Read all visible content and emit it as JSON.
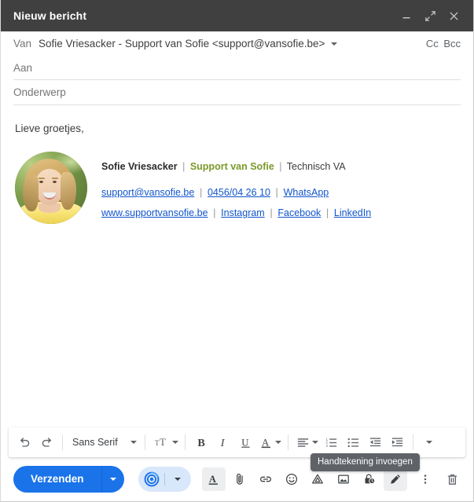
{
  "window": {
    "title": "Nieuw bericht",
    "buttons": [
      {
        "name": "minimize",
        "label": "Minimaliseren"
      },
      {
        "name": "expand",
        "label": "Volledig scherm"
      },
      {
        "name": "close",
        "label": "Sluiten"
      }
    ]
  },
  "fields": {
    "from_label": "Van",
    "from_value": "Sofie Vriesacker - Support van Sofie <support@vansofie.be>",
    "cc": "Cc",
    "bcc": "Bcc",
    "to_placeholder": "Aan",
    "subject_placeholder": "Onderwerp"
  },
  "body": {
    "greeting": "Lieve groetjes,",
    "signature": {
      "avatar_alt": "Sofie Vriesacker portret",
      "name": "Sofie Vriesacker",
      "brand": "Support van Sofie",
      "role": "Technisch VA",
      "separator": "|",
      "contact_links": [
        "support@vansofie.be",
        "0456/04 26 10",
        "WhatsApp"
      ],
      "social_links": [
        "www.supportvansofie.be",
        "Instagram",
        "Facebook",
        "LinkedIn"
      ]
    }
  },
  "format_toolbar": {
    "undo": "Ongedaan maken",
    "redo": "Opnieuw",
    "font_family": "Sans Serif",
    "font_size": "Tekengrootte",
    "bold": "Vet",
    "italic": "Cursief",
    "underline": "Onderstrepen",
    "text_color": "Tekstkleur",
    "align": "Uitlijnen",
    "numbered_list": "Genummerde lijst",
    "bulleted_list": "Lijst met opsommingstekens",
    "outdent": "Inspringing verkleinen",
    "indent": "Inspringing vergroten",
    "more": "Meer opties"
  },
  "tooltip": {
    "text": "Handtekening invoegen"
  },
  "bottom_bar": {
    "send_label": "Verzenden",
    "send_options": "Verzendopties",
    "ai_label": "Help mij schrijven",
    "ai_options": "Opties",
    "icons": [
      {
        "name": "formatting-options-icon",
        "label": "Opmaakopties",
        "active": true
      },
      {
        "name": "attach-file-icon",
        "label": "Bestanden bijvoegen",
        "active": false
      },
      {
        "name": "insert-link-icon",
        "label": "Link invoegen",
        "active": false
      },
      {
        "name": "insert-emoji-icon",
        "label": "Emoji invoegen",
        "active": false
      },
      {
        "name": "insert-drive-icon",
        "label": "Bestanden invoegen via Drive",
        "active": false
      },
      {
        "name": "insert-photo-icon",
        "label": "Foto invoegen",
        "active": false
      },
      {
        "name": "confidential-mode-icon",
        "label": "Vertrouwelijke modus aan-/uitzetten",
        "active": false
      },
      {
        "name": "insert-signature-icon",
        "label": "Handtekening invoegen",
        "active": true
      }
    ],
    "more_options": "Meer opties",
    "discard": "Concept verwijderen"
  },
  "colors": {
    "header_bg": "#404040",
    "accent_blue": "#1a73e8",
    "link_blue": "#1155cc",
    "brand_green": "#7a9a2b",
    "tooltip_bg": "#5f6368"
  }
}
